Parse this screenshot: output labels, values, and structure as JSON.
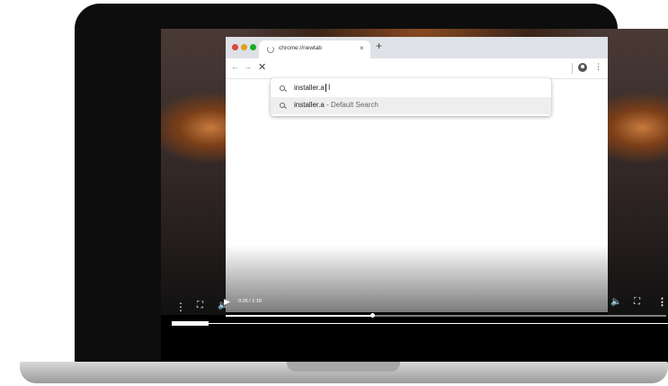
{
  "browser": {
    "tab_title": "chrome://newtab",
    "tab_close": "×",
    "new_tab": "+",
    "nav_back": "←",
    "nav_forward": "→",
    "nav_stop": "✕",
    "menu": "⋮"
  },
  "omnibox": {
    "input_value": "installer.a",
    "suggestion_query": "installer.a",
    "suggestion_separator": "-",
    "suggestion_desc": "Default Search"
  },
  "player": {
    "time": "0:26 / 1:18",
    "progress": 0.333,
    "outer_progress": 0.075,
    "icons": {
      "play": "▶",
      "volume": "🔈",
      "fullscreen": "⛶",
      "more": "⋮"
    }
  },
  "colors": {
    "tab_strip": "#dee1e6",
    "traffic_red": "#e0443e",
    "traffic_yellow": "#dea123",
    "traffic_green": "#1aab29"
  }
}
